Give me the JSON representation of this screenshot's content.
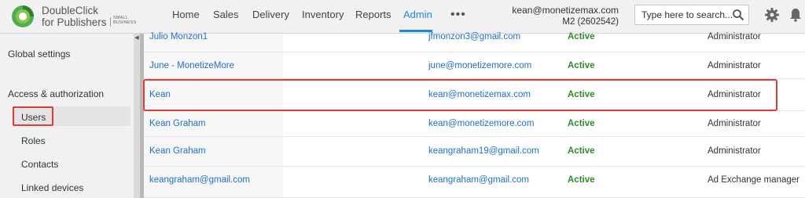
{
  "brand": {
    "line1": "DoubleClick",
    "line2": "for Publishers",
    "small1": "SMALL",
    "small2": "BUSINESS"
  },
  "nav": [
    {
      "label": "Home"
    },
    {
      "label": "Sales"
    },
    {
      "label": "Delivery"
    },
    {
      "label": "Inventory"
    },
    {
      "label": "Reports"
    },
    {
      "label": "Admin",
      "active": true
    }
  ],
  "more_label": "•••",
  "account": {
    "email": "kean@monetizemax.com",
    "network": "M2 (2602542)"
  },
  "search": {
    "placeholder": "Type here to search..."
  },
  "icons": {
    "search": "search-icon",
    "settings": "gear-icon",
    "notifications": "bell-icon",
    "collapse": "chevron-left-icon"
  },
  "sidebar": {
    "global_settings": "Global settings",
    "section_title": "Access & authorization",
    "items": [
      {
        "label": "Users",
        "selected": true
      },
      {
        "label": "Roles"
      },
      {
        "label": "Contacts"
      },
      {
        "label": "Linked devices"
      }
    ]
  },
  "users": [
    {
      "name": "Julio Monzon1",
      "email": "jfmonzon3@gmail.com",
      "status": "Active",
      "role": "Administrator"
    },
    {
      "name": "June - MonetizeMore",
      "email": "june@monetizemore.com",
      "status": "Active",
      "role": "Administrator"
    },
    {
      "name": "Kean",
      "email": "kean@monetizemax.com",
      "status": "Active",
      "role": "Administrator"
    },
    {
      "name": "Kean Graham",
      "email": "kean@monetizemore.com",
      "status": "Active",
      "role": "Administrator"
    },
    {
      "name": "Kean Graham",
      "email": "keangraham19@gmail.com",
      "status": "Active",
      "role": "Administrator"
    },
    {
      "name": "keangraham@gmail.com",
      "email": "keangraham@gmail.com",
      "status": "Active",
      "role": "Ad Exchange manager"
    }
  ],
  "colors": {
    "link": "#1e6fd6",
    "active_status": "#2e8b2e",
    "nav_active": "#1e88e5",
    "annotation": "#e53935",
    "logo_green": "#4caf50"
  }
}
